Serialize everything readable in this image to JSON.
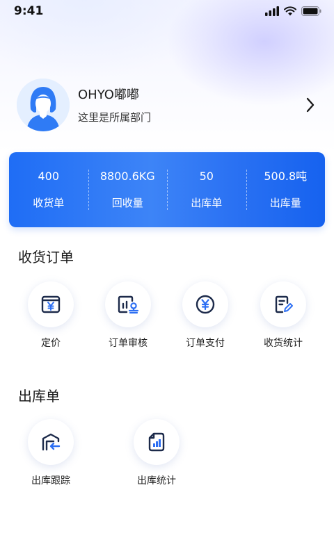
{
  "status_bar": {
    "time": "9:41"
  },
  "profile": {
    "name": "OHYO嘟嘟",
    "department": "这里是所属部门"
  },
  "stats": [
    {
      "value": "400",
      "label": "收货单"
    },
    {
      "value": "8800.6KG",
      "label": "回收量"
    },
    {
      "value": "50",
      "label": "出库单"
    },
    {
      "value": "500.8吨",
      "label": "出库量"
    }
  ],
  "receiving_section": {
    "title": "收货订单",
    "items": [
      {
        "label": "定价",
        "icon": "price-tag-icon"
      },
      {
        "label": "订单审核",
        "icon": "order-review-icon"
      },
      {
        "label": "订单支付",
        "icon": "yen-coin-icon"
      },
      {
        "label": "收货统计",
        "icon": "document-edit-icon"
      }
    ]
  },
  "outbound_section": {
    "title": "出库单",
    "items": [
      {
        "label": "出库跟踪",
        "icon": "warehouse-out-icon"
      },
      {
        "label": "出库统计",
        "icon": "report-chart-icon"
      }
    ]
  },
  "colors": {
    "accent": "#1f6df5",
    "icon_blue": "#2d6ff3",
    "icon_dark": "#1c2a4a"
  }
}
